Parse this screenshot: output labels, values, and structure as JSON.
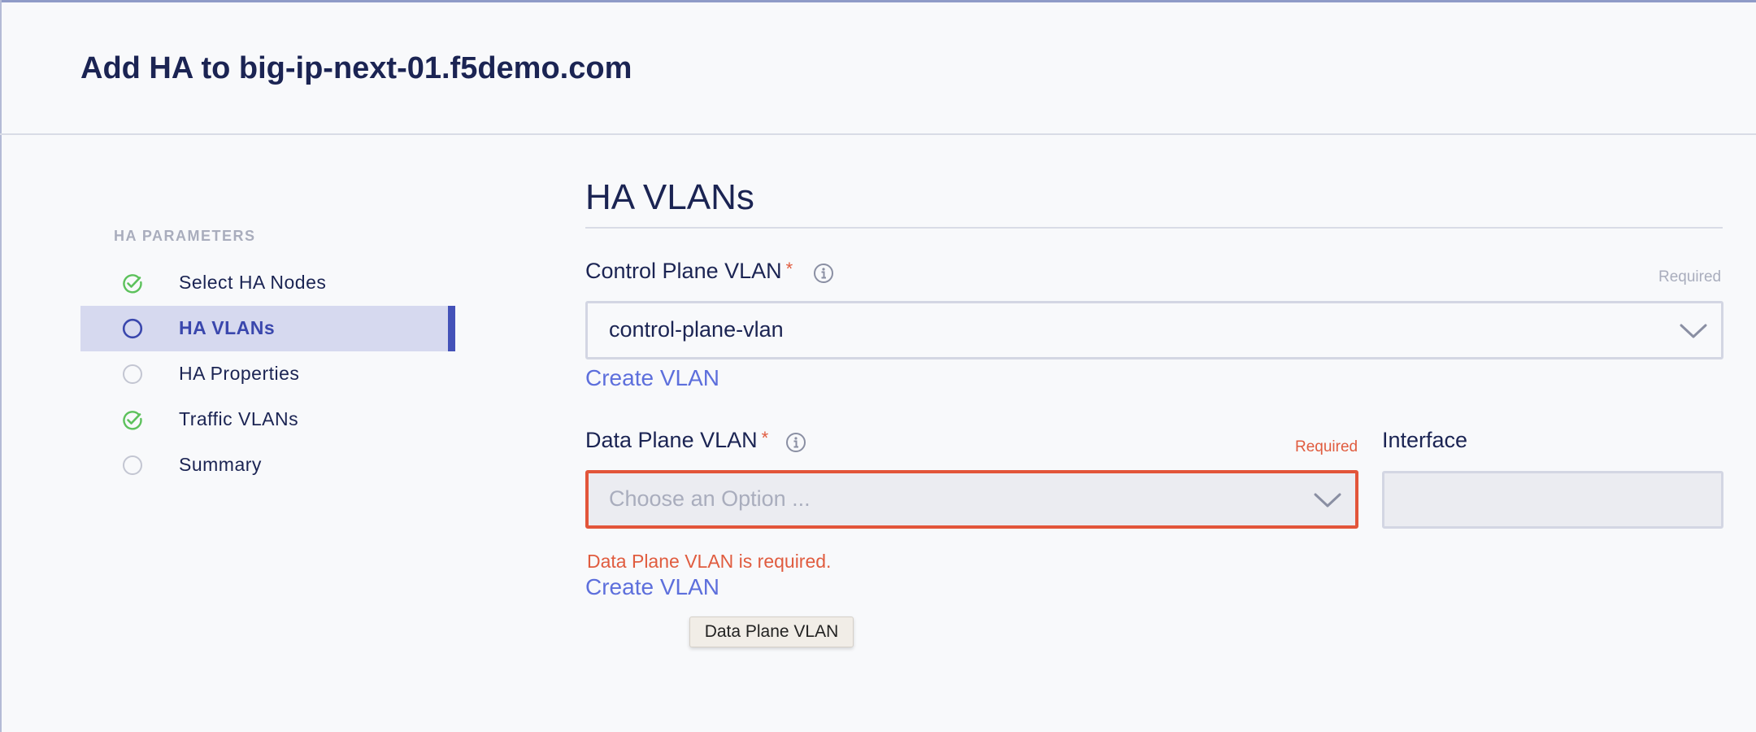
{
  "header": {
    "title": "Add HA to big-ip-next-01.f5demo.com"
  },
  "sidebar": {
    "section_title": "HA PARAMETERS",
    "steps": [
      {
        "label": "Select HA Nodes",
        "status": "complete",
        "icon": "check-circle-icon"
      },
      {
        "label": "HA VLANs",
        "status": "active",
        "icon": "circle-icon"
      },
      {
        "label": "HA Properties",
        "status": "pending",
        "icon": "circle-icon"
      },
      {
        "label": "Traffic VLANs",
        "status": "complete",
        "icon": "check-circle-icon"
      },
      {
        "label": "Summary",
        "status": "pending",
        "icon": "circle-icon"
      }
    ]
  },
  "main": {
    "section_title": "HA VLANs",
    "control_plane": {
      "label": "Control Plane VLAN",
      "required_mark": "*",
      "required_hint": "Required",
      "value": "control-plane-vlan",
      "create_link": "Create VLAN"
    },
    "data_plane": {
      "label": "Data Plane VLAN",
      "required_mark": "*",
      "required_hint": "Required",
      "placeholder": "Choose an Option ...",
      "error": "Data Plane VLAN is required.",
      "create_link": "Create VLAN"
    },
    "interface": {
      "label": "Interface",
      "value": ""
    },
    "tooltip": "Data Plane VLAN"
  },
  "colors": {
    "accent": "#4452b8",
    "link": "#5d6fdc",
    "error": "#e05c3f",
    "success": "#5cc15b",
    "muted": "#a9adbd"
  }
}
